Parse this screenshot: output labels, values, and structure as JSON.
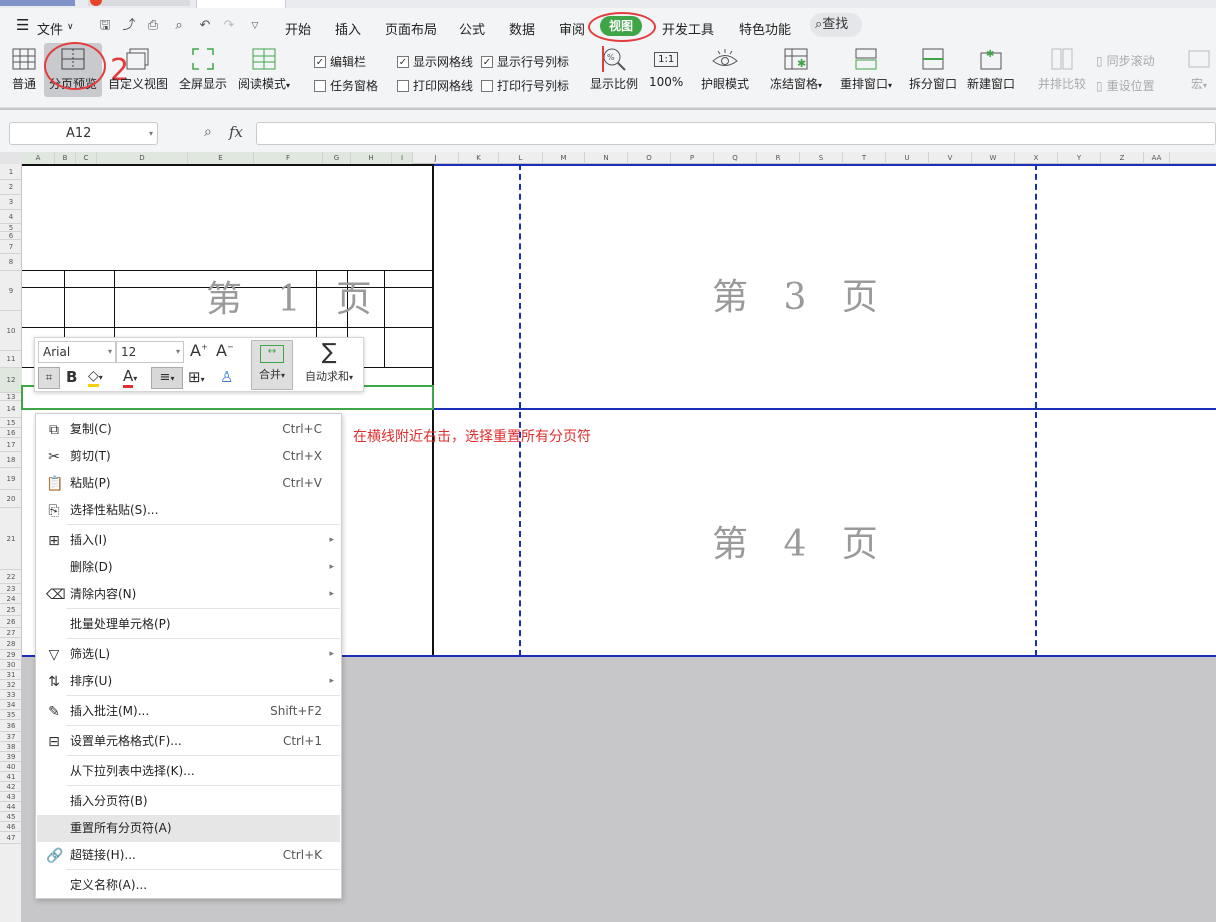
{
  "menubar": {
    "file": "文件",
    "tabs": [
      "开始",
      "插入",
      "页面布局",
      "公式",
      "数据",
      "审阅"
    ],
    "active_tab": "视图",
    "tabs_after": [
      "开发工具",
      "特色功能"
    ],
    "search": "查找"
  },
  "ribbon": {
    "normal": "普通",
    "page_break_preview": "分页预览",
    "custom_view": "自定义视图",
    "fullscreen": "全屏显示",
    "reading_mode": "阅读模式",
    "edit_bar": "编辑栏",
    "task_pane": "任务窗格",
    "show_gridlines": "显示网格线",
    "print_gridlines": "打印网格线",
    "show_headers": "显示行号列标",
    "print_headers": "打印行号列标",
    "zoom": "显示比例",
    "zoom_100": "100%",
    "eye_mode": "护眼模式",
    "freeze": "冻结窗格",
    "arrange": "重排窗口",
    "split": "拆分窗口",
    "new_window": "新建窗口",
    "side_by_side": "并排比较",
    "sync_scroll": "同步滚动",
    "reset_position": "重设位置",
    "macro": "宏"
  },
  "formula_bar": {
    "name_box": "A12",
    "fx": "fx"
  },
  "columns": [
    "A",
    "B",
    "C",
    "D",
    "E",
    "F",
    "G",
    "H",
    "I",
    "J",
    "K",
    "L",
    "M",
    "N",
    "O",
    "P",
    "Q",
    "R",
    "S",
    "T",
    "U",
    "V",
    "W",
    "X",
    "Y",
    "Z",
    "AA"
  ],
  "rows": [
    "1",
    "2",
    "3",
    "4",
    "5",
    "6",
    "7",
    "8",
    "9",
    "10",
    "11",
    "12",
    "13",
    "14",
    "15",
    "16",
    "17",
    "18",
    "19",
    "20",
    "21",
    "22",
    "23",
    "24",
    "25",
    "26",
    "27",
    "28",
    "29",
    "30",
    "31",
    "32",
    "33",
    "34",
    "35",
    "36",
    "37",
    "38",
    "39",
    "40",
    "41",
    "42",
    "43",
    "44",
    "45",
    "46",
    "47"
  ],
  "pages": {
    "p1": "第 1 页",
    "p3": "第 3 页",
    "p4": "第 4 页"
  },
  "mini_toolbar": {
    "font": "Arial",
    "size": "12",
    "merge": "合并",
    "autosum": "自动求和"
  },
  "context_menu": {
    "copy": {
      "label": "复制(C)",
      "shortcut": "Ctrl+C"
    },
    "cut": {
      "label": "剪切(T)",
      "shortcut": "Ctrl+X"
    },
    "paste": {
      "label": "粘贴(P)",
      "shortcut": "Ctrl+V"
    },
    "paste_special": {
      "label": "选择性粘贴(S)..."
    },
    "insert": {
      "label": "插入(I)"
    },
    "delete": {
      "label": "删除(D)"
    },
    "clear": {
      "label": "清除内容(N)"
    },
    "batch": {
      "label": "批量处理单元格(P)"
    },
    "filter": {
      "label": "筛选(L)"
    },
    "sort": {
      "label": "排序(U)"
    },
    "insert_comment": {
      "label": "插入批注(M)...",
      "shortcut": "Shift+F2"
    },
    "format_cells": {
      "label": "设置单元格格式(F)...",
      "shortcut": "Ctrl+1"
    },
    "pick_list": {
      "label": "从下拉列表中选择(K)..."
    },
    "insert_break": {
      "label": "插入分页符(B)"
    },
    "reset_breaks": {
      "label": "重置所有分页符(A)"
    },
    "hyperlink": {
      "label": "超链接(H)...",
      "shortcut": "Ctrl+K"
    },
    "define_name": {
      "label": "定义名称(A)..."
    }
  },
  "annotation": "在横线附近右击，选择重置所有分页符",
  "colors": {
    "accent_green": "#3fa648",
    "annotation_red": "#e02e2e",
    "page_break_blue": "#1a2fb5"
  }
}
